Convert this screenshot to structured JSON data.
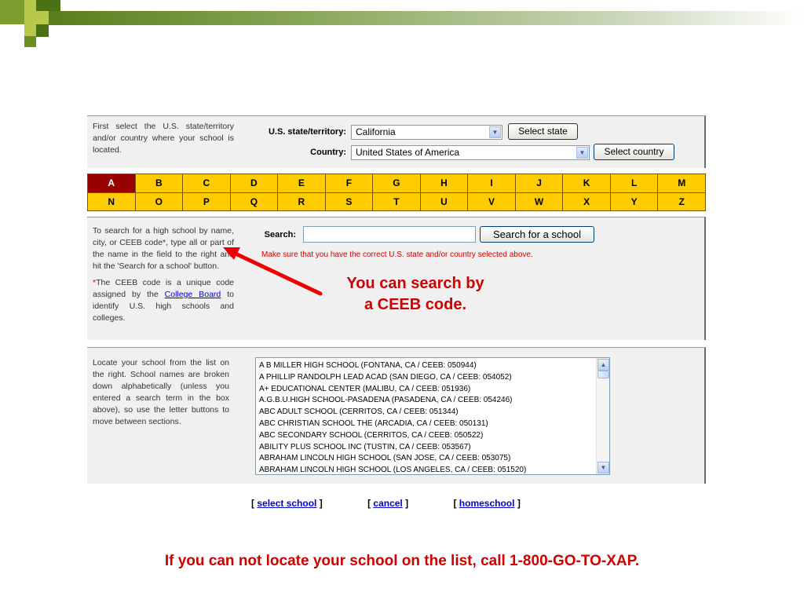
{
  "state_panel": {
    "description": "First select the U.S. state/territory and/or country where your school is located.",
    "state_label": "U.S. state/territory:",
    "state_value": "California",
    "select_state_button": "Select state",
    "country_label": "Country:",
    "country_value": "United States of America",
    "select_country_button": "Select country"
  },
  "letters": [
    [
      "A",
      "B",
      "C",
      "D",
      "E",
      "F",
      "G",
      "H",
      "I",
      "J",
      "K",
      "L",
      "M"
    ],
    [
      "N",
      "O",
      "P",
      "Q",
      "R",
      "S",
      "T",
      "U",
      "V",
      "W",
      "X",
      "Y",
      "Z"
    ]
  ],
  "active_letter": "A",
  "search_panel": {
    "description": "To search for a high school by name, city, or CEEB code*, type all or part of the name in the field to the right and hit the 'Search for a school' button.",
    "note_star": "*",
    "note_before_link": "The CEEB code is a unique code assigned by the ",
    "note_link": "College Board",
    "note_after_link": " to identify U.S. high schools and colleges.",
    "search_label": "Search:",
    "search_value": "",
    "search_button": "Search for a school",
    "hint": "Make sure that you have the correct U.S. state and/or country selected above."
  },
  "list_panel": {
    "description": "Locate your school from the list on the right. School names are broken down alphabetically (unless you entered a search term in the box above), so use the letter buttons to move between sections.",
    "schools": [
      "A B MILLER HIGH SCHOOL   (FONTANA, CA / CEEB: 050944)",
      "A PHILLIP RANDOLPH LEAD ACAD   (SAN DIEGO, CA / CEEB: 054052)",
      "A+ EDUCATIONAL CENTER   (MALIBU, CA / CEEB: 051936)",
      "A.G.B.U.HIGH SCHOOL-PASADENA   (PASADENA, CA / CEEB: 054246)",
      "ABC ADULT SCHOOL   (CERRITOS, CA / CEEB: 051344)",
      "ABC CHRISTIAN SCHOOL THE   (ARCADIA, CA / CEEB: 050131)",
      "ABC SECONDARY SCHOOL   (CERRITOS, CA / CEEB: 050522)",
      "ABILITY PLUS SCHOOL INC   (TUSTIN, CA / CEEB: 053567)",
      "ABRAHAM LINCOLN HIGH SCHOOL   (SAN JOSE, CA / CEEB: 053075)",
      "ABRAHAM LINCOLN HIGH SCHOOL   (LOS ANGELES, CA / CEEB: 051520)"
    ]
  },
  "footer_links": {
    "select_school": "select school",
    "cancel": "cancel",
    "homeschool": "homeschool"
  },
  "callout": {
    "line1": "You can search by",
    "line2": "a CEEB code."
  },
  "bottom_note": "If you can not locate your school on the list, call 1-800-GO-TO-XAP.",
  "colors": {
    "accent_red": "#cc0000",
    "letter_bg": "#ffcc00",
    "letter_active_bg": "#990000",
    "banner_green": "#5a7d1a"
  }
}
